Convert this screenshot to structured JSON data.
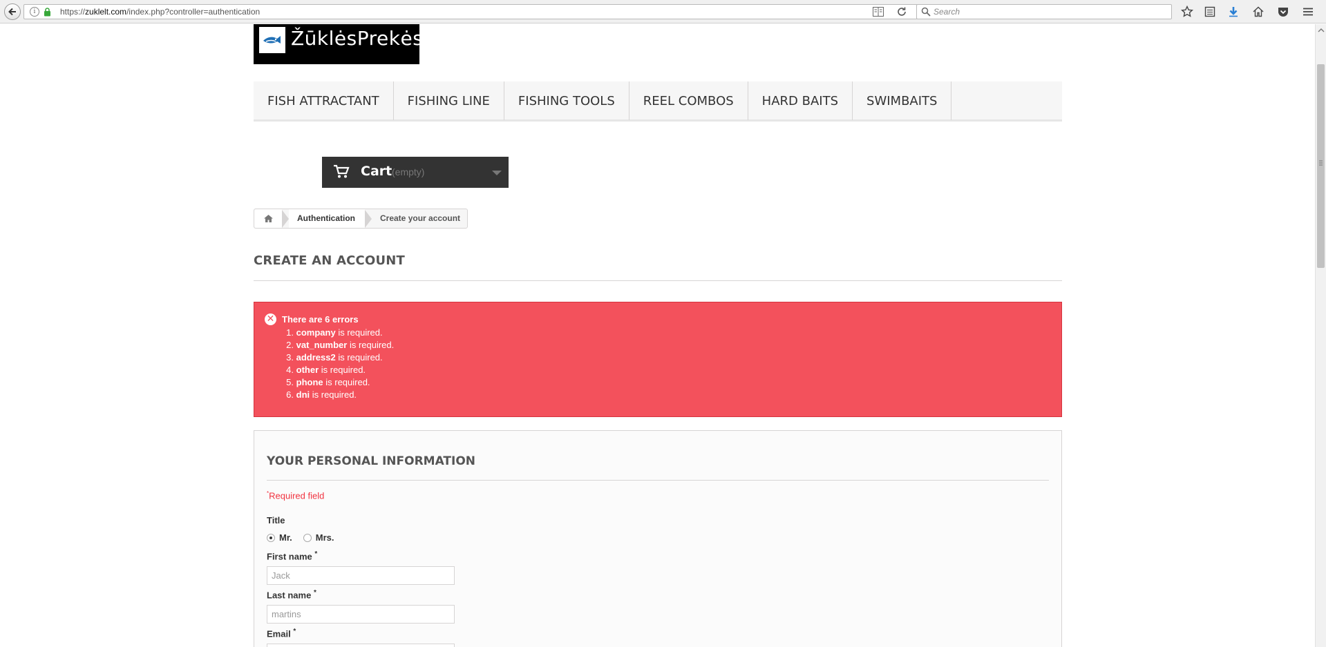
{
  "browser": {
    "url_prefix": "https://",
    "url_host": "zuklelt.com",
    "url_path": "/index.php?controller=authentication",
    "search_placeholder": "Search"
  },
  "logo": {
    "text": "ŽūklėsPrekės"
  },
  "menu": {
    "items": [
      {
        "label": "FISH ATTRACTANT"
      },
      {
        "label": "FISHING LINE"
      },
      {
        "label": "FISHING TOOLS"
      },
      {
        "label": "REEL COMBOS"
      },
      {
        "label": "HARD BAITS"
      },
      {
        "label": "SWIMBAITS"
      }
    ]
  },
  "cart": {
    "label": "Cart",
    "status": "(empty)"
  },
  "breadcrumb": {
    "link": "Authentication",
    "current": "Create your account"
  },
  "page": {
    "heading": "CREATE AN ACCOUNT"
  },
  "alert": {
    "title": "There are 6 errors",
    "errors": [
      {
        "num": "1.",
        "field": "company",
        "msg": " is required."
      },
      {
        "num": "2.",
        "field": "vat_number",
        "msg": " is required."
      },
      {
        "num": "3.",
        "field": "address2",
        "msg": " is required."
      },
      {
        "num": "4.",
        "field": "other",
        "msg": " is required."
      },
      {
        "num": "5.",
        "field": "phone",
        "msg": " is required."
      },
      {
        "num": "6.",
        "field": "dni",
        "msg": " is required."
      }
    ]
  },
  "form": {
    "heading": "YOUR PERSONAL INFORMATION",
    "required_mark": "*",
    "required_note": "Required field",
    "title_label": "Title",
    "title_options": [
      "Mr.",
      "Mrs."
    ],
    "title_selected": "Mr.",
    "first_name_label": "First name",
    "first_name_value": "Jack",
    "last_name_label": "Last name",
    "last_name_value": "martins",
    "email_label": "Email",
    "email_value": ""
  },
  "colors": {
    "alert_bg": "#f3515c",
    "required_red": "#f13340",
    "cart_bg": "#333333"
  }
}
